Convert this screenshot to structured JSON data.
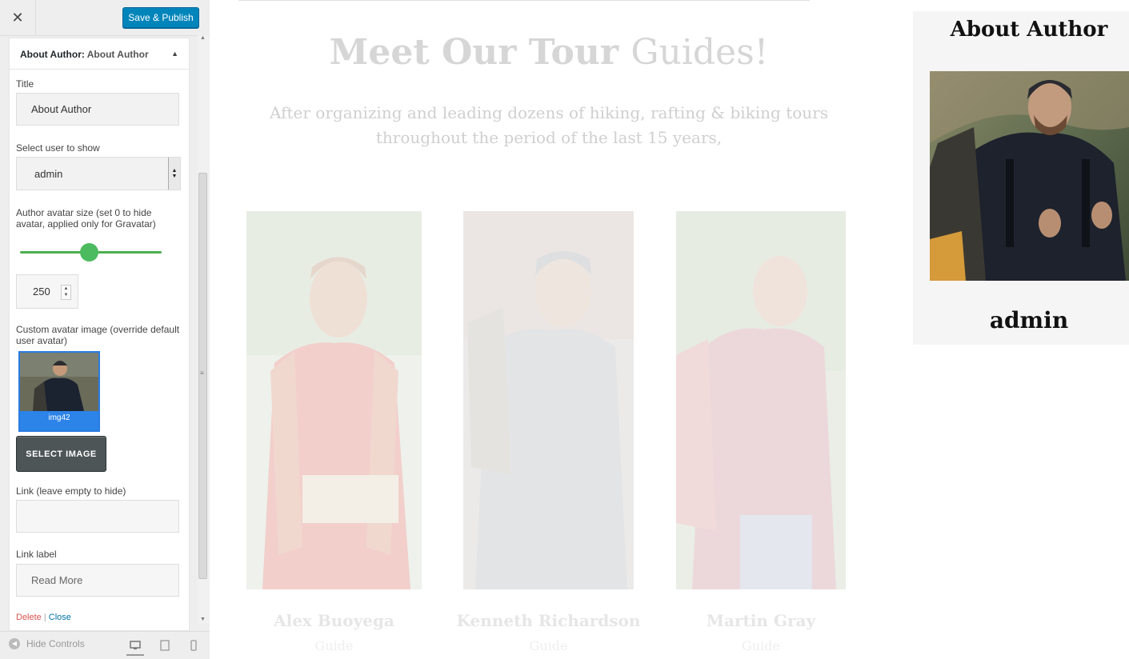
{
  "topbar": {
    "close_glyph": "✕",
    "save_label": "Save & Publish"
  },
  "widget": {
    "title_bold": "About Author:",
    "title_sub": " About Author",
    "arrow": "▲"
  },
  "form": {
    "title_label": "Title",
    "title_value": "About Author",
    "user_label": "Select user to show",
    "user_value": "admin",
    "avatar_size_label": "Author avatar size (set 0 to hide avatar, applied only for Gravatar)",
    "avatar_size_value": "250",
    "avatar_size_fraction": 0.49,
    "custom_avatar_label": "Custom avatar image (override default user avatar)",
    "avatar_filename": "img42",
    "select_image_label": "SELECT IMAGE",
    "link_label": "Link (leave empty to hide)",
    "link_value": "",
    "link_text_label": "Link label",
    "link_text_value": "Read More",
    "delete_label": "Delete",
    "separator": " | ",
    "close_label": "Close"
  },
  "footer": {
    "hide_controls_label": "Hide Controls",
    "devices": [
      "desktop-icon",
      "tablet-icon",
      "mobile-icon"
    ],
    "active_device": "desktop"
  },
  "preview": {
    "heading_bold": "Meet Our Tour ",
    "heading_light": "Guides!",
    "subtitle": "After organizing and leading dozens of hiking, rafting & biking tours throughout the period of the last 15 years,",
    "guides": [
      {
        "name": "Alex Buoyega",
        "role": "Guide"
      },
      {
        "name": "Kenneth Richardson",
        "role": "Guide"
      },
      {
        "name": "Martin Gray",
        "role": "Guide"
      }
    ],
    "author_widget_title": "About Author",
    "author_name": "admin"
  },
  "colors": {
    "accent": "#0085ba",
    "slider": "#4cbb5f",
    "delete": "#d9534f",
    "close": "#0073aa"
  }
}
